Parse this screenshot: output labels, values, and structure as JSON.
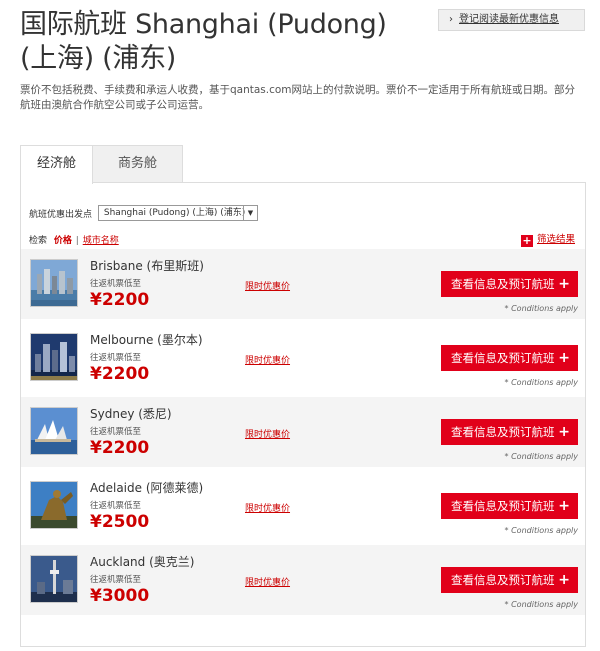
{
  "header": {
    "title": "国际航班 Shanghai (Pudong) (上海) (浦东)",
    "signup_label": "登记阅读最新优惠信息",
    "note": "票价不包括税费、手续费和承运人收费，基于qantas.com网站上的付款说明。票价不一定适用于所有航班或日期。部分航班由澳航合作航空公司或子公司运营。"
  },
  "tabs": [
    {
      "label": "经济舱",
      "selected": true
    },
    {
      "label": "商务舱",
      "selected": false
    }
  ],
  "origin": {
    "label": "航班优惠出发点",
    "selected": "Shanghai (Pudong) (上海) (浦东)"
  },
  "sort": {
    "label": "检索",
    "active": "价格",
    "separator": "|",
    "other": "城市名称"
  },
  "filter": {
    "label": "筛选结果"
  },
  "destinations": [
    {
      "city": "Brisbane (布里斯班)",
      "from_label": "往返机票低至",
      "price": "¥2200",
      "offer": "限时优惠价",
      "button": "查看信息及预订航班",
      "conditions": "* Conditions apply",
      "image_icon": "brisbane-skyline"
    },
    {
      "city": "Melbourne (墨尔本)",
      "from_label": "往返机票低至",
      "price": "¥2200",
      "offer": "限时优惠价",
      "button": "查看信息及预订航班",
      "conditions": "* Conditions apply",
      "image_icon": "melbourne-skyline"
    },
    {
      "city": "Sydney (悉尼)",
      "from_label": "往返机票低至",
      "price": "¥2200",
      "offer": "限时优惠价",
      "button": "查看信息及预订航班",
      "conditions": "* Conditions apply",
      "image_icon": "sydney-opera-house"
    },
    {
      "city": "Adelaide (阿德莱德)",
      "from_label": "往返机票低至",
      "price": "¥2500",
      "offer": "限时优惠价",
      "button": "查看信息及预订航班",
      "conditions": "* Conditions apply",
      "image_icon": "adelaide-statue"
    },
    {
      "city": "Auckland (奥克兰)",
      "from_label": "往返机票低至",
      "price": "¥3000",
      "offer": "限时优惠价",
      "button": "查看信息及预订航班",
      "conditions": "* Conditions apply",
      "image_icon": "auckland-sky-tower"
    }
  ],
  "colors": {
    "accent": "#e1001a",
    "price": "#cc0000"
  }
}
